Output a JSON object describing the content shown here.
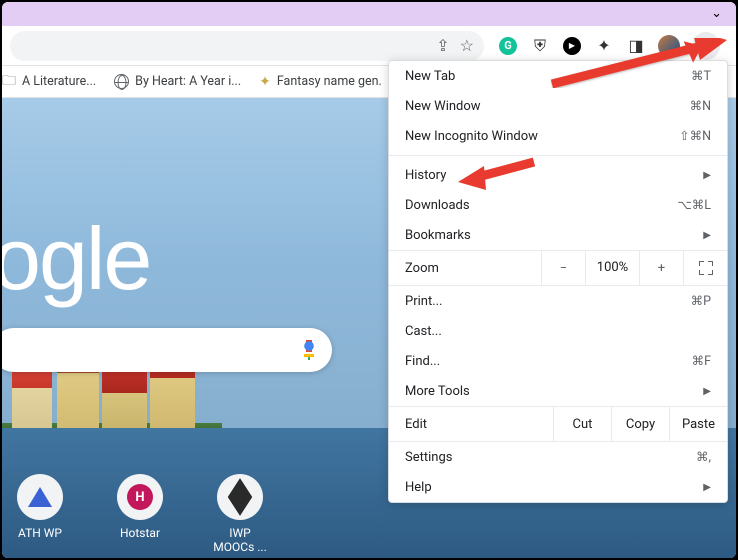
{
  "toolbar": {
    "share_icon": "⇪",
    "star_icon": "☆"
  },
  "bookmarks": [
    {
      "label": "A Literature...",
      "icon": "folder"
    },
    {
      "label": "By Heart: A Year i...",
      "icon": "globe"
    },
    {
      "label": "Fantasy name gen.",
      "icon": "gold"
    }
  ],
  "logo_text": "ogle",
  "shortcuts": [
    {
      "label": "ATH WP",
      "glyph": "triangle"
    },
    {
      "label": "Hotstar",
      "glyph": "H"
    },
    {
      "label": "IWP MOOCs ...",
      "glyph": "cube"
    }
  ],
  "menu": {
    "new_tab": {
      "label": "New Tab",
      "key": "⌘T"
    },
    "new_window": {
      "label": "New Window",
      "key": "⌘N"
    },
    "new_incognito": {
      "label": "New Incognito Window",
      "key": "⇧⌘N"
    },
    "history": {
      "label": "History"
    },
    "downloads": {
      "label": "Downloads",
      "key": "⌥⌘L"
    },
    "bookmarks": {
      "label": "Bookmarks"
    },
    "zoom_label": "Zoom",
    "zoom_minus": "−",
    "zoom_value": "100%",
    "zoom_plus": "+",
    "print": {
      "label": "Print...",
      "key": "⌘P"
    },
    "cast": {
      "label": "Cast..."
    },
    "find": {
      "label": "Find...",
      "key": "⌘F"
    },
    "more_tools": {
      "label": "More Tools"
    },
    "edit_label": "Edit",
    "edit_cut": "Cut",
    "edit_copy": "Copy",
    "edit_paste": "Paste",
    "settings": {
      "label": "Settings",
      "key": "⌘,"
    },
    "help": {
      "label": "Help"
    }
  }
}
